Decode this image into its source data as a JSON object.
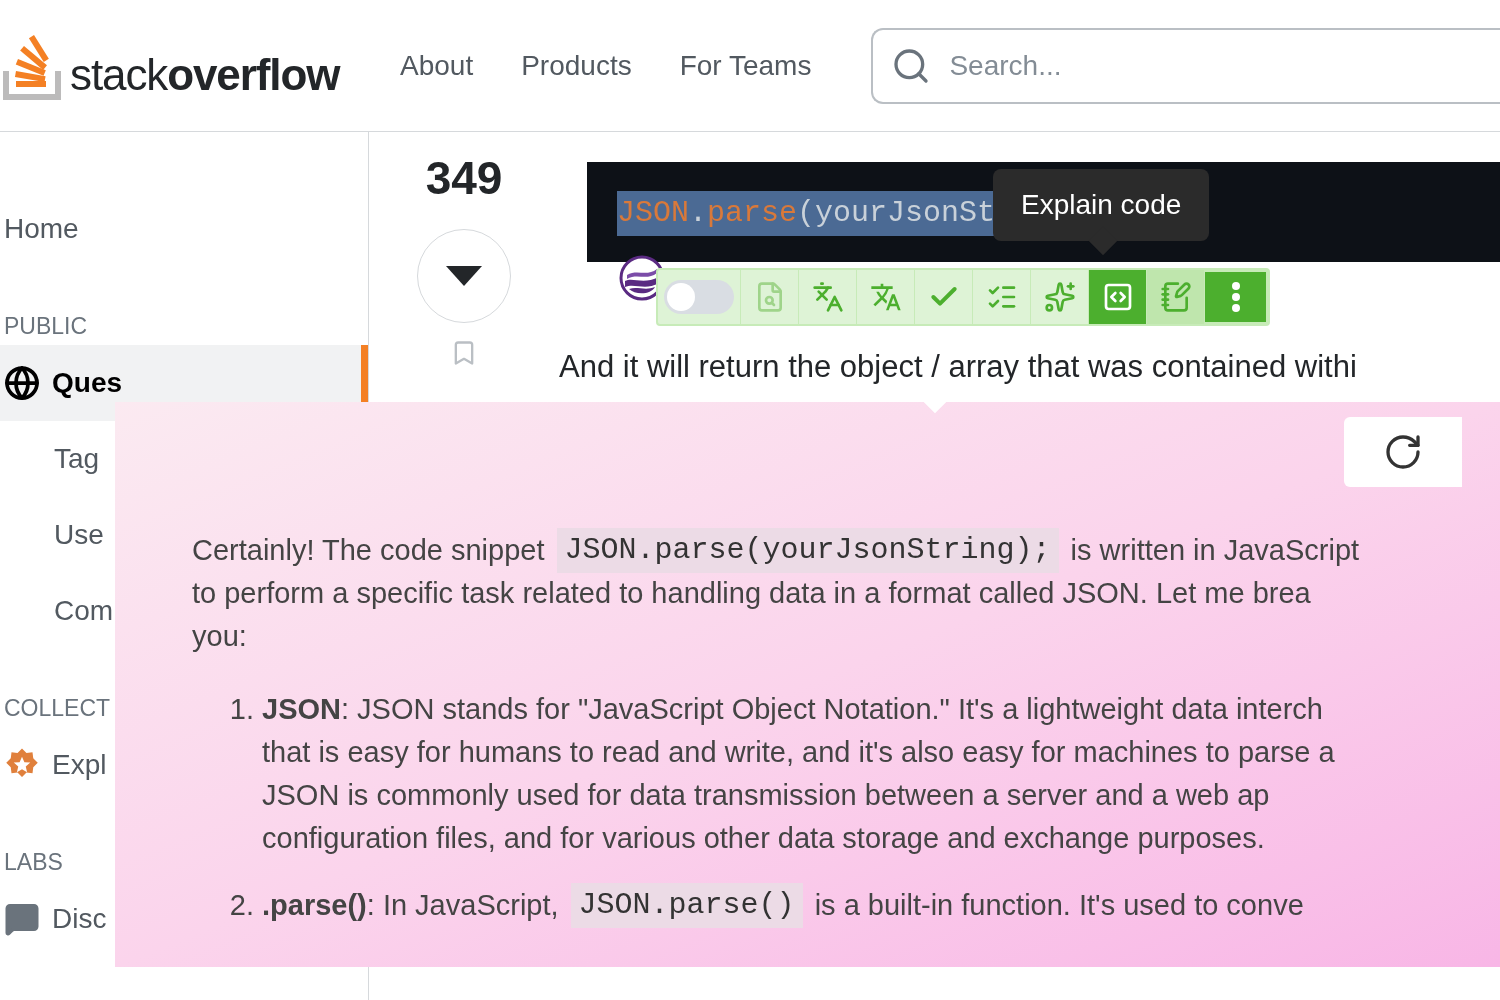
{
  "header": {
    "logo": "stack**overflow**",
    "nav": [
      {
        "label": "About",
        "selected": false
      },
      {
        "label": "Products",
        "selected": false
      },
      {
        "label": "For Teams",
        "selected": false
      }
    ],
    "search": {
      "placeholder": "Search..."
    }
  },
  "sidebar": {
    "sections": [
      {
        "items": [
          {
            "label": "Home",
            "selected": false
          }
        ]
      },
      {
        "heading": "PUBLIC",
        "items": [
          {
            "label": "Ques",
            "selected": true
          },
          {
            "label": "Tag",
            "selected": false
          },
          {
            "label": "Use",
            "selected": false
          },
          {
            "label": "Com",
            "selected": false
          }
        ]
      },
      {
        "heading": "COLLECT",
        "items": [
          {
            "label": "Expl",
            "selected": false
          }
        ]
      },
      {
        "heading": "LABS",
        "items": [
          {
            "label": "Disc",
            "selected": false
          }
        ]
      }
    ]
  },
  "question": {
    "votes": "349",
    "code": {
      "selected": true,
      "tokens": [
        {
          "kind": "builtin",
          "text": "JSON"
        },
        {
          "kind": "punct",
          "text": "."
        },
        {
          "kind": "method",
          "text": "parse"
        },
        {
          "kind": "plain",
          "text": "(yourJsonSt"
        }
      ]
    },
    "tooltip": "Explain code",
    "toolbar": {
      "toggle": {
        "on": false
      },
      "buttons": [
        {
          "kind": "lookup",
          "selected": false
        },
        {
          "kind": "translate_box",
          "selected": false
        },
        {
          "kind": "translate",
          "selected": false
        },
        {
          "kind": "check",
          "selected": false
        },
        {
          "kind": "summary",
          "selected": false
        },
        {
          "kind": "sparkle",
          "selected": false
        },
        {
          "kind": "explain",
          "selected": true
        },
        {
          "kind": "note",
          "selected": false
        },
        {
          "kind": "more",
          "selected": false
        }
      ]
    },
    "answer_text": "And it will return the object / array that was contained withi"
  },
  "explanation": {
    "intro": [
      [
        {
          "kind": "text",
          "text": "Certainly! The code snippet"
        },
        {
          "kind": "code",
          "text": "JSON.parse(yourJsonString);"
        },
        {
          "kind": "text",
          "text": "is written in JavaScript"
        }
      ],
      [
        {
          "kind": "text",
          "text": "to perform a specific task related to handling data in a format called JSON. Let me brea"
        }
      ],
      [
        {
          "kind": "text",
          "text": "you:"
        }
      ]
    ],
    "items": [
      {
        "number": "1.",
        "lines": [
          [
            {
              "kind": "text",
              "text": "**JSON**: JSON stands for \"JavaScript Object Notation.\" It's a lightweight data interch"
            }
          ],
          [
            {
              "kind": "text",
              "text": "that is easy for humans to read and write, and it's also easy for machines to parse a"
            }
          ],
          [
            {
              "kind": "text",
              "text": "JSON is commonly used for data transmission between a server and a web ap"
            }
          ],
          [
            {
              "kind": "text",
              "text": "configuration files, and for various other data storage and exchange purposes."
            }
          ]
        ]
      },
      {
        "number": "2.",
        "lines": [
          [
            {
              "kind": "text",
              "text": "**.parse()**: In JavaScript,"
            },
            {
              "kind": "code",
              "text": "JSON.parse()"
            },
            {
              "kind": "text",
              "text": "is a built-in function. It's used to conve"
            }
          ]
        ]
      }
    ]
  }
}
